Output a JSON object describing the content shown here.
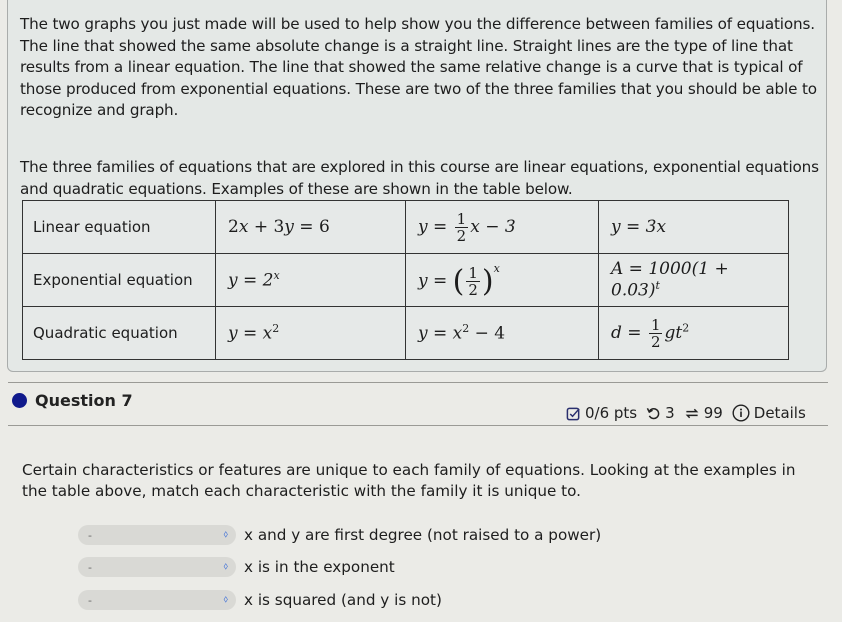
{
  "intro": {
    "paragraph1": "The two graphs you just made will be used to help show you the difference between families of equations. The line that showed the same absolute change is a straight line.  Straight lines are the type of line that results from a linear equation.  The line that showed the same relative change is a curve that is typical of those produced from exponential equations.  These are two of the three families that you should be able to recognize and graph.",
    "paragraph2": "The three families of equations that are explored in this course are linear equations, exponential equations and quadratic equations.  Examples of these are shown in the table below."
  },
  "table": {
    "rows": [
      {
        "family": "Linear equation",
        "examples": [
          "2x + 3y = 6",
          "y = (1/2)x − 3",
          "y = 3x"
        ]
      },
      {
        "family": "Exponential equation",
        "examples": [
          "y = 2^x",
          "y = (1/2)^x",
          "A = 1000(1 + 0.03)^t"
        ]
      },
      {
        "family": "Quadratic equation",
        "examples": [
          "y = x^2",
          "y = x^2 − 4",
          "d = (1/2)gt^2"
        ]
      }
    ],
    "math": {
      "r0c0": {
        "a": "2",
        "x": "x",
        "b": " + 3",
        "y": "y",
        "rest": " = 6"
      },
      "r0c1": {
        "lhs": "y = ",
        "num": "1",
        "den": "2",
        "rest": "x − 3"
      },
      "r0c2": {
        "lhs": "y = 3",
        "v": "x"
      },
      "r1c0": {
        "lhs": "y = 2",
        "exp": "x"
      },
      "r1c1": {
        "lhs": "y = ",
        "num": "1",
        "den": "2",
        "exp": "x"
      },
      "r1c2": {
        "lhs": "A = 1000(1 + 0.03)",
        "exp": "t"
      },
      "r2c0": {
        "lhs": "y = x",
        "exp": "2"
      },
      "r2c1": {
        "lhs": "y = x",
        "exp": "2",
        "rest": " − 4"
      },
      "r2c2": {
        "lhs": "d = ",
        "num": "1",
        "den": "2",
        "mid": "gt",
        "exp": "2"
      }
    }
  },
  "question": {
    "title": "Question 7",
    "points": "0/6 pts",
    "retries": "3",
    "attempts": "99",
    "details_label": "Details",
    "accent_color": "#101a8c",
    "prompt": "Certain characteristics or features are unique to each family of equations.  Looking at the examples in the table above, match each characteristic with the family it is unique to.",
    "matches": [
      {
        "selected": "-",
        "label": "x and y are first degree (not raised to a power)"
      },
      {
        "selected": "-",
        "label": "x is in the exponent"
      },
      {
        "selected": "-",
        "label": "x is squared (and y is not)"
      }
    ]
  }
}
